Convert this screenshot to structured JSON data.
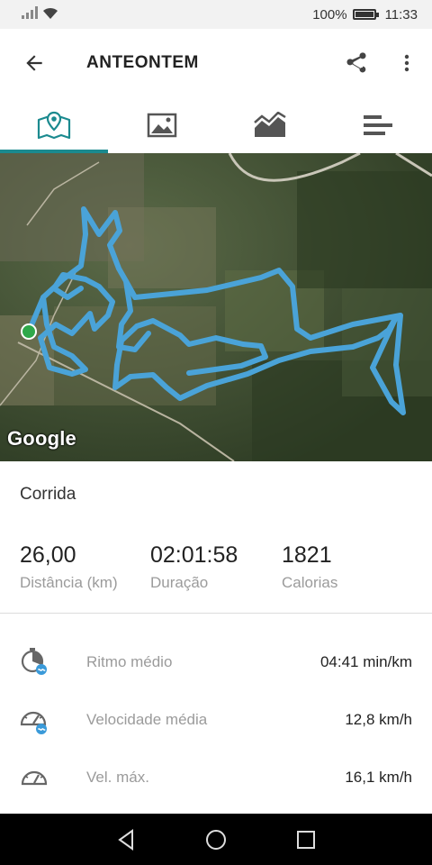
{
  "status": {
    "battery": "100%",
    "time": "11:33"
  },
  "appbar": {
    "title": "ANTEONTEM",
    "back_icon": "arrow-left-icon",
    "share_icon": "share-icon",
    "more_icon": "more-vert-icon"
  },
  "tabs": [
    {
      "icon": "map-icon",
      "active": true
    },
    {
      "icon": "image-icon",
      "active": false
    },
    {
      "icon": "chart-icon",
      "active": false
    },
    {
      "icon": "bars-icon",
      "active": false
    }
  ],
  "map": {
    "attribution": "Google",
    "route_color": "#4aa3d8",
    "start_color": "#2ea84a"
  },
  "activity": {
    "type": "Corrida"
  },
  "stats": [
    {
      "value": "26,00",
      "label": "Distância (km)"
    },
    {
      "value": "02:01:58",
      "label": "Duração"
    },
    {
      "value": "1821",
      "label": "Calorias"
    }
  ],
  "metrics": [
    {
      "icon": "pace-icon",
      "name": "Ritmo médio",
      "value": "04:41 min/km"
    },
    {
      "icon": "speedometer-icon",
      "name": "Velocidade média",
      "value": "12,8 km/h"
    },
    {
      "icon": "speedometer-max-icon",
      "name": "Vel. máx.",
      "value": "16,1 km/h"
    }
  ],
  "colors": {
    "accent": "#1b8a8f",
    "route": "#4aa3d8"
  }
}
